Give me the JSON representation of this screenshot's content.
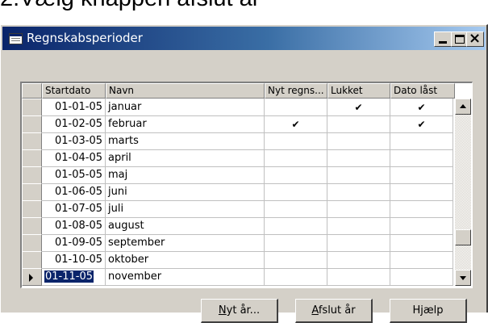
{
  "caption": "2.Vælg knappen afslut år",
  "window": {
    "title": "Regnskabsperioder",
    "controls": {
      "minimize": "_",
      "maximize": "□",
      "close": "×"
    }
  },
  "table": {
    "columns": [
      "Startdato",
      "Navn",
      "Nyt regns...",
      "Lukket",
      "Dato låst"
    ],
    "rows": [
      {
        "date": "01-01-05",
        "name": "januar",
        "nyt": "",
        "lukket": "✔",
        "dato": "✔"
      },
      {
        "date": "01-02-05",
        "name": "februar",
        "nyt": "✔",
        "lukket": "",
        "dato": "✔"
      },
      {
        "date": "01-03-05",
        "name": "marts",
        "nyt": "",
        "lukket": "",
        "dato": ""
      },
      {
        "date": "01-04-05",
        "name": "april",
        "nyt": "",
        "lukket": "",
        "dato": ""
      },
      {
        "date": "01-05-05",
        "name": "maj",
        "nyt": "",
        "lukket": "",
        "dato": ""
      },
      {
        "date": "01-06-05",
        "name": "juni",
        "nyt": "",
        "lukket": "",
        "dato": ""
      },
      {
        "date": "01-07-05",
        "name": "juli",
        "nyt": "",
        "lukket": "",
        "dato": ""
      },
      {
        "date": "01-08-05",
        "name": "august",
        "nyt": "",
        "lukket": "",
        "dato": ""
      },
      {
        "date": "01-09-05",
        "name": "september",
        "nyt": "",
        "lukket": "",
        "dato": ""
      },
      {
        "date": "01-10-05",
        "name": "oktober",
        "nyt": "",
        "lukket": "",
        "dato": ""
      },
      {
        "date": "01-11-05",
        "name": "november",
        "nyt": "",
        "lukket": "",
        "dato": ""
      }
    ]
  },
  "buttons": {
    "nyt_ar_u": "N",
    "nyt_ar_rest": "yt år...",
    "afslut_u": "A",
    "afslut_rest": "fslut år",
    "hjaelp": "Hjælp"
  },
  "colors": {
    "titlebar": "#0a246a",
    "window": "#d4d0c8",
    "selection": "#0a246a"
  }
}
